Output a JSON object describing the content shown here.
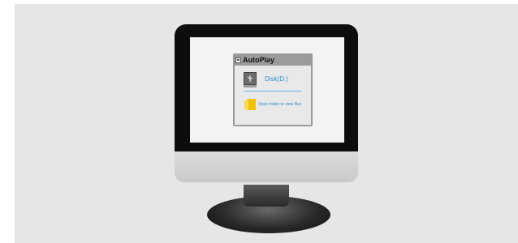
{
  "window": {
    "title": "AutoPlay",
    "title_icon": "autoplay-window-icon"
  },
  "drive": {
    "label": "Disk(D:)",
    "icon": "usb-drive-icon"
  },
  "action": {
    "label": "Open folder to view files",
    "icon": "folder-icon"
  },
  "colors": {
    "link_blue": "#2a8fd4",
    "folder_yellow": "#f2c300",
    "background": "#e6e6e6",
    "bezel": "#0d0d0d"
  }
}
